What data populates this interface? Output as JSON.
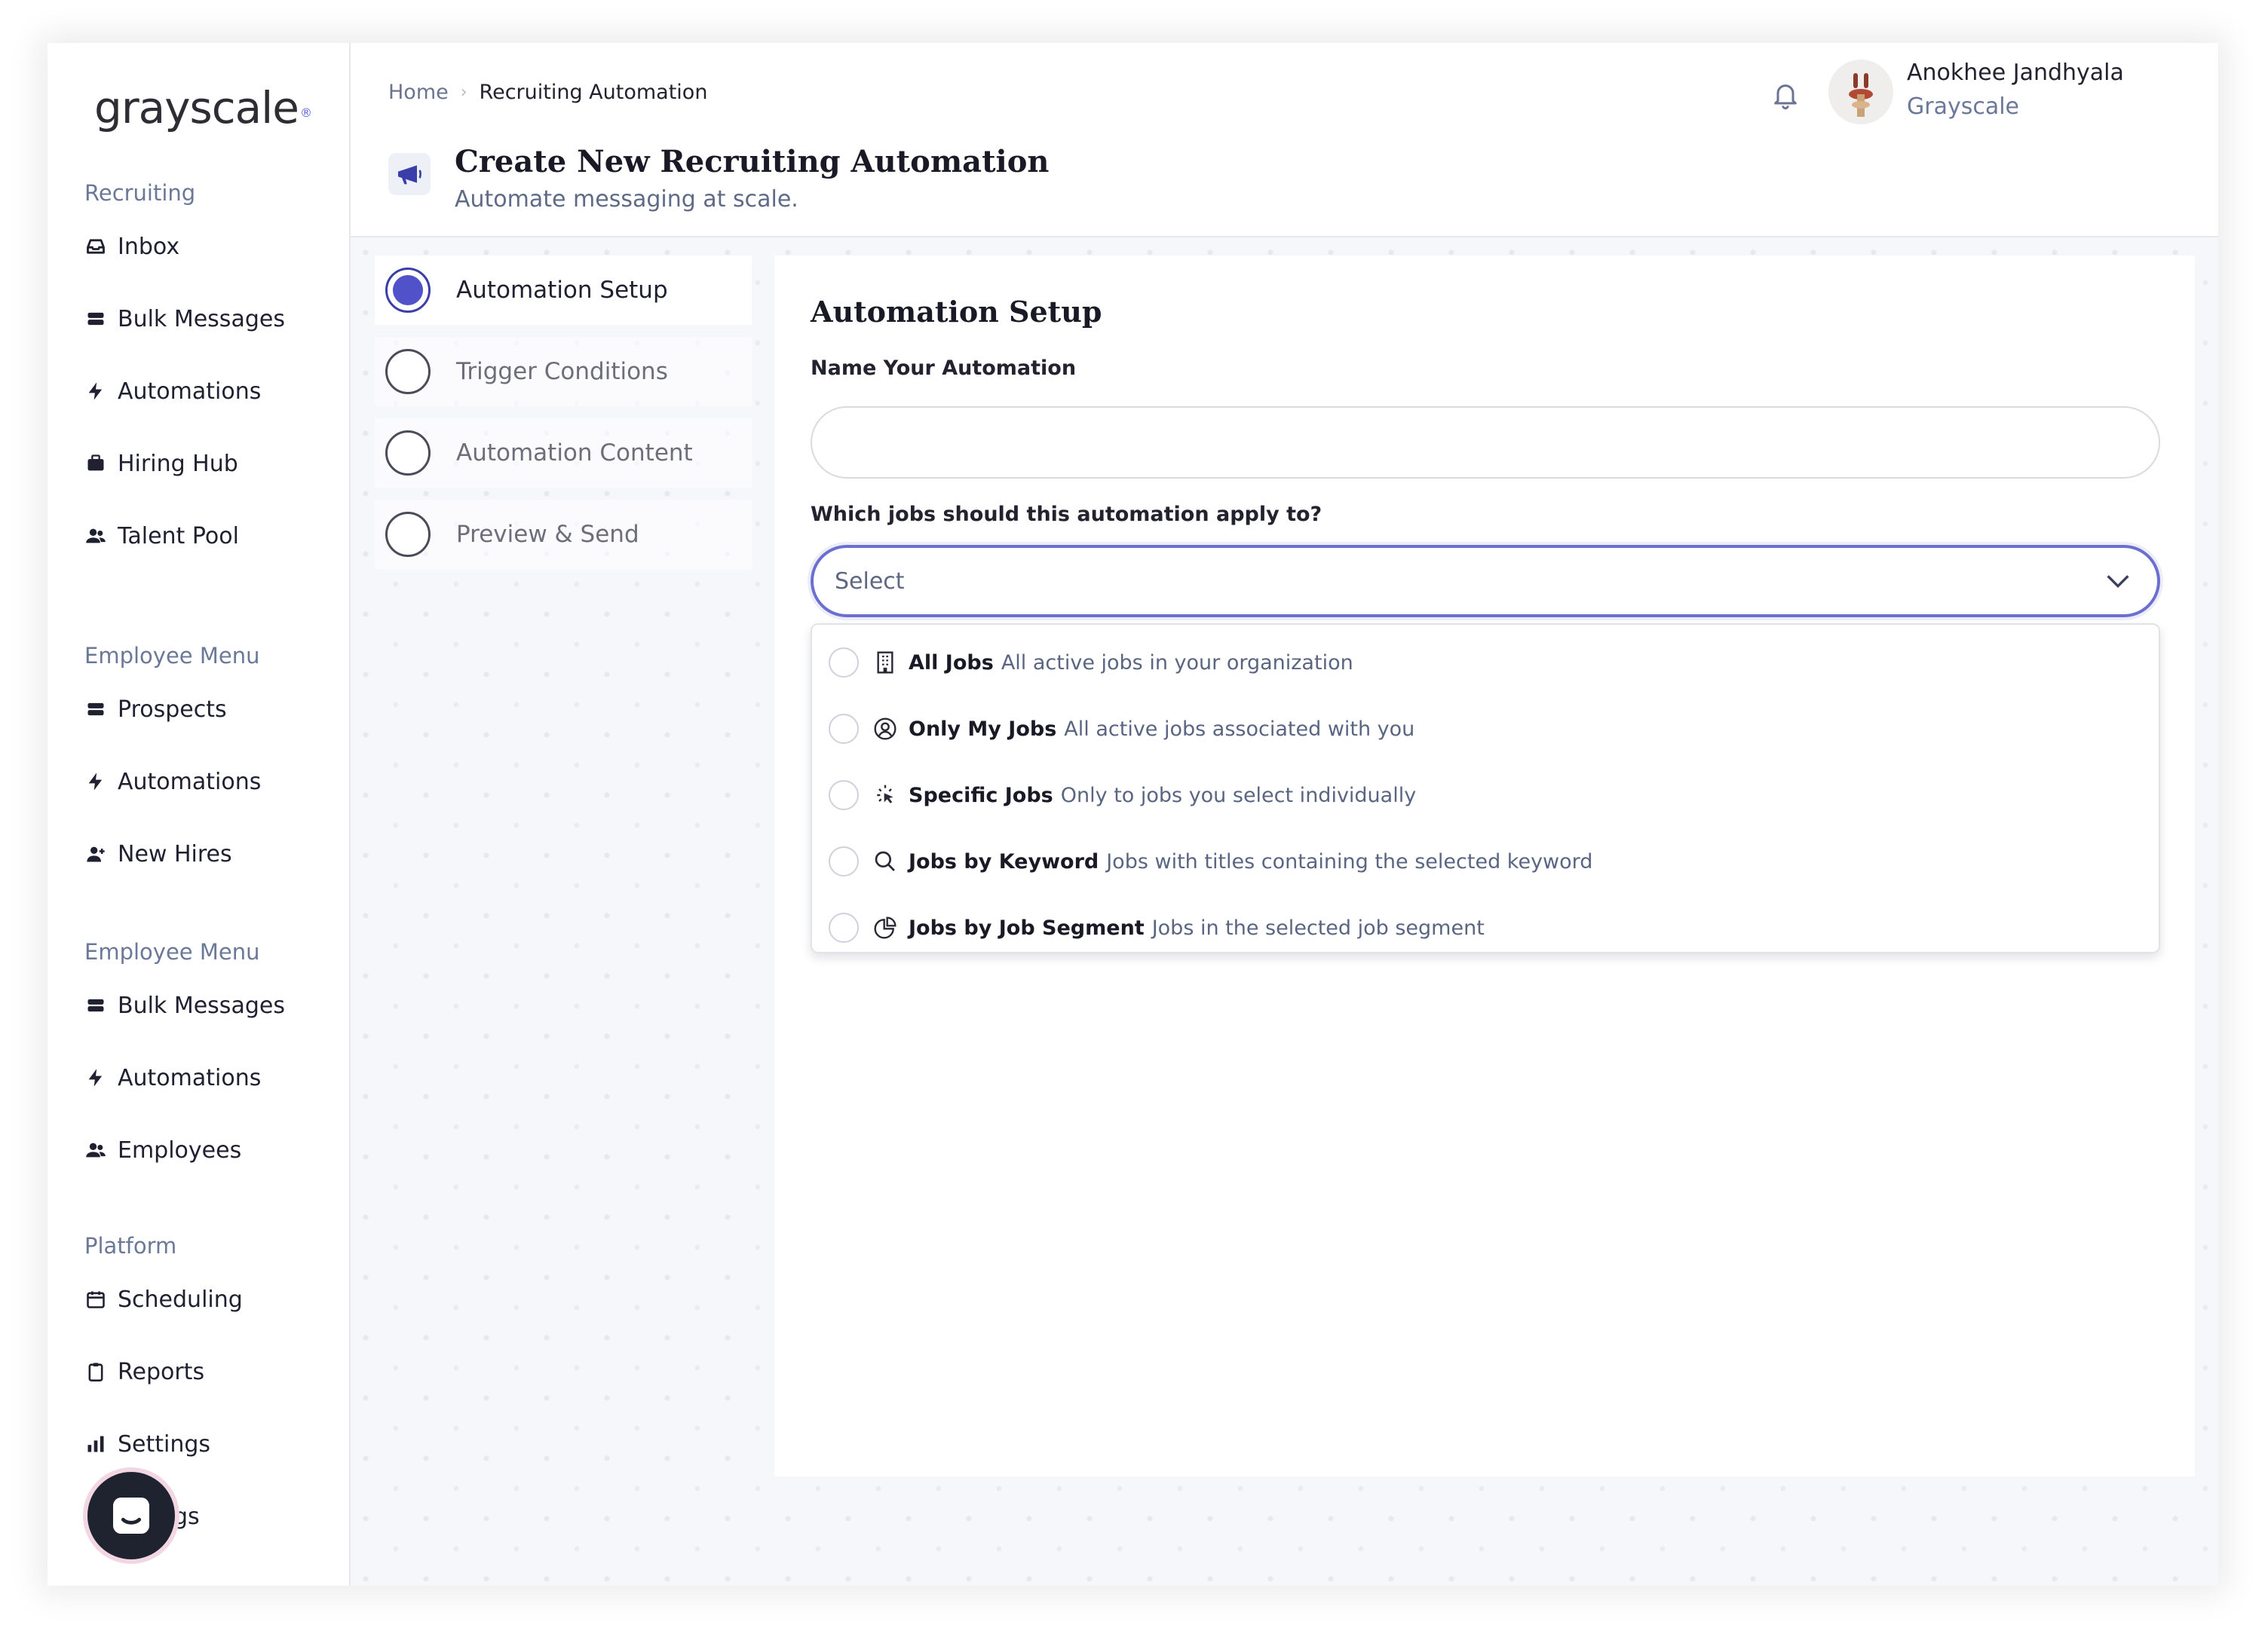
{
  "brand": {
    "logo_text": "grayscale",
    "logo_mark": "®"
  },
  "sidebar": {
    "sections": [
      {
        "heading": "Recruiting",
        "items": [
          {
            "label": "Inbox",
            "icon": "inbox-icon"
          },
          {
            "label": "Bulk Messages",
            "icon": "stack-icon"
          },
          {
            "label": "Automations",
            "icon": "bolt-icon"
          },
          {
            "label": "Hiring Hub",
            "icon": "briefcase-icon"
          },
          {
            "label": "Talent Pool",
            "icon": "users-icon"
          }
        ]
      },
      {
        "heading": "Employee Menu",
        "items": [
          {
            "label": "Prospects",
            "icon": "stack-icon"
          },
          {
            "label": "Automations",
            "icon": "bolt-icon"
          },
          {
            "label": "New Hires",
            "icon": "user-plus-icon"
          }
        ]
      },
      {
        "heading": "Employee Menu",
        "items": [
          {
            "label": "Bulk Messages",
            "icon": "stack-icon"
          },
          {
            "label": "Automations",
            "icon": "bolt-icon"
          },
          {
            "label": "Employees",
            "icon": "users-icon"
          }
        ]
      },
      {
        "heading": "Platform",
        "items": [
          {
            "label": "Scheduling",
            "icon": "calendar-icon"
          },
          {
            "label": "Reports",
            "icon": "clipboard-icon"
          },
          {
            "label": "Settings",
            "icon": "bar-chart-icon"
          },
          {
            "label": "gs",
            "icon": "gear-icon"
          }
        ]
      }
    ]
  },
  "header": {
    "breadcrumb": {
      "home": "Home",
      "current": "Recruiting Automation"
    },
    "title": "Create New Recruiting Automation",
    "subtitle": "Automate messaging at scale.",
    "user": {
      "name": "Anokhee Jandhyala",
      "org": "Grayscale"
    }
  },
  "steps": [
    {
      "label": "Automation Setup",
      "active": true
    },
    {
      "label": "Trigger Conditions",
      "active": false
    },
    {
      "label": "Automation Content",
      "active": false
    },
    {
      "label": "Preview & Send",
      "active": false
    }
  ],
  "form": {
    "title": "Automation Setup",
    "name_label": "Name Your Automation",
    "name_value": "",
    "jobs_label": "Which jobs should this automation apply to?",
    "jobs_placeholder": "Select",
    "options": [
      {
        "name": "All Jobs",
        "desc": "All active jobs in your organization",
        "icon": "building-icon"
      },
      {
        "name": "Only My Jobs",
        "desc": "All active jobs associated with you",
        "icon": "user-circle-icon"
      },
      {
        "name": "Specific Jobs",
        "desc": "Only to jobs you select individually",
        "icon": "cursor-click-icon"
      },
      {
        "name": "Jobs by Keyword",
        "desc": "Jobs with titles containing the selected keyword",
        "icon": "search-icon"
      },
      {
        "name": "Jobs by Job Segment",
        "desc": "Jobs in the selected job segment",
        "icon": "pie-chart-icon"
      }
    ]
  },
  "colors": {
    "accent": "#4f52c8",
    "focus_border": "#6a6fd0",
    "muted_text": "#6b7898"
  }
}
